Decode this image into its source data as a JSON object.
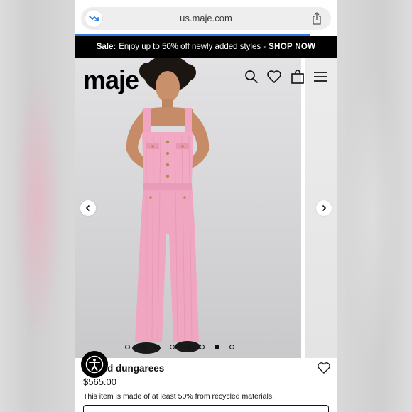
{
  "browser": {
    "url": "us.maje.com"
  },
  "banner": {
    "sale_label": "Sale:",
    "message": "Enjoy up to 50% off newly added styles -",
    "cta": "SHOP NOW"
  },
  "header": {
    "logo": "maje",
    "icons": [
      "search-icon",
      "heart-icon",
      "bag-icon",
      "menu-icon"
    ]
  },
  "gallery": {
    "image_count": 8,
    "active_index": 6
  },
  "product": {
    "name": "d dungarees",
    "price": "$565.00",
    "note": "This item is made of at least 50% from recycled materials."
  },
  "colors": {
    "accent_blue": "#2f7be6",
    "banner_bg": "#000000",
    "product_pink": "#f0a6c0"
  }
}
